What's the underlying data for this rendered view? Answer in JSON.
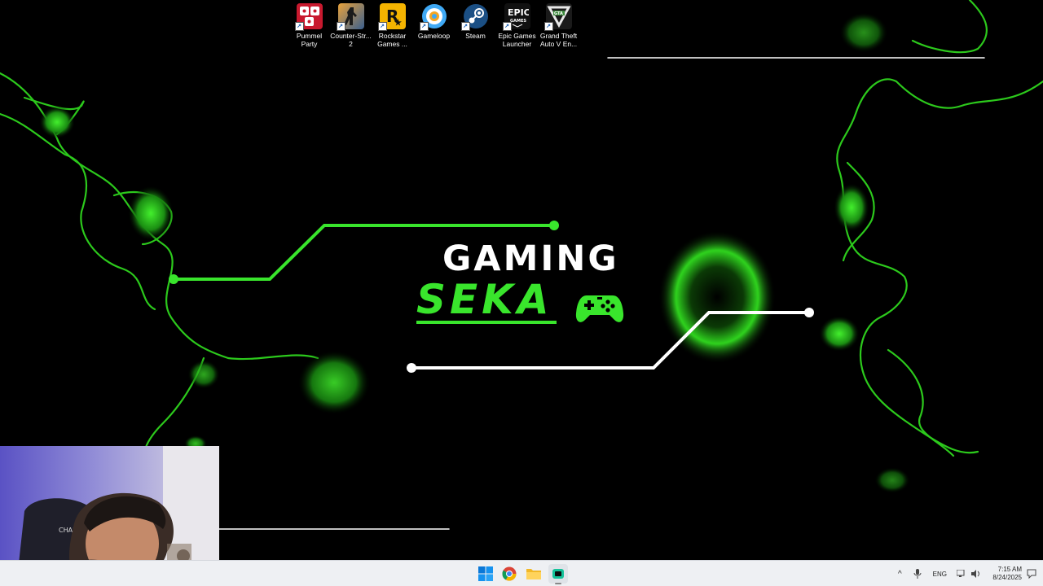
{
  "desktop": {
    "icons": [
      {
        "label": "Pummel Party",
        "icon": "pummel-party-icon",
        "color": "#c8192e"
      },
      {
        "label": "Counter-Str... 2",
        "icon": "counter-strike-icon",
        "color": "#3a5f8f"
      },
      {
        "label": "Rockstar Games ...",
        "icon": "rockstar-icon",
        "color": "#f5b400"
      },
      {
        "label": "Gameloop",
        "icon": "gameloop-icon",
        "color": "#3fa9f5"
      },
      {
        "label": "Steam",
        "icon": "steam-icon",
        "color": "#1b2838"
      },
      {
        "label": "Epic Games Launcher",
        "icon": "epic-games-icon",
        "color": "#111111"
      },
      {
        "label": "Grand Theft Auto V En...",
        "icon": "gta-v-icon",
        "color": "#1a1a1a"
      }
    ]
  },
  "wallpaper": {
    "title_top": "GAMING",
    "title_bottom": "SEKA",
    "accent": "#39e52c"
  },
  "taskbar": {
    "apps": [
      "start-icon",
      "chrome-icon",
      "file-explorer-icon",
      "obs-icon"
    ],
    "language": "ENG",
    "time": "7:15 AM",
    "date": "8/24/2025"
  }
}
